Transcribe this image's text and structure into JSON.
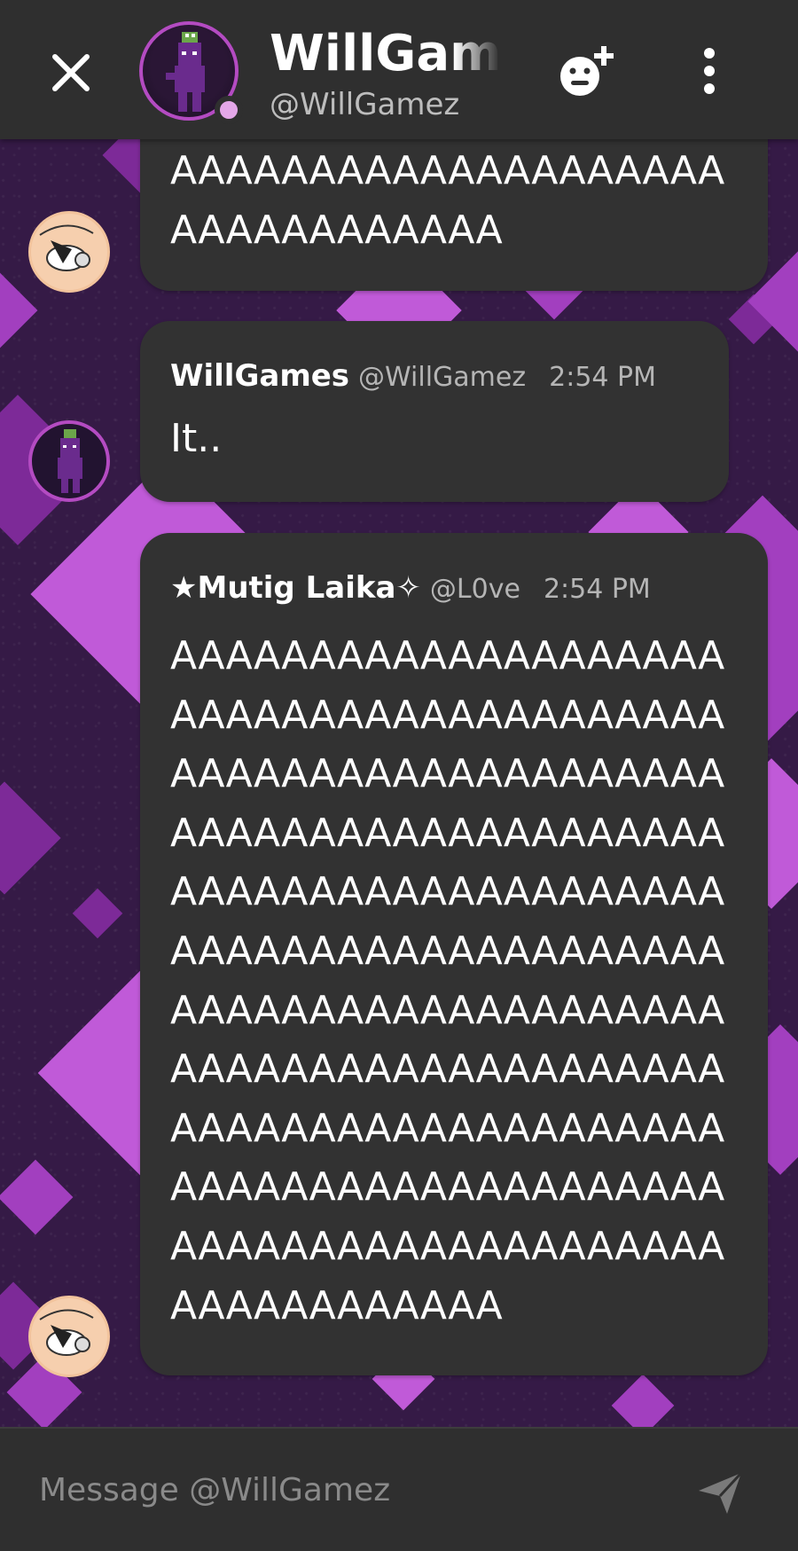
{
  "header": {
    "title": "WillGames",
    "handle": "@WillGamez"
  },
  "messages": [
    {
      "id": "partial",
      "author": "",
      "text": "AAAAAAAAAAAAAAAAAAAA\nAAAAAAAAAAAA"
    },
    {
      "id": "will",
      "author": "WillGames",
      "handle": "@WillGamez",
      "time": "2:54 PM",
      "text": "It.."
    },
    {
      "id": "laika",
      "author": "★Mutig Laika✧",
      "handle": "@L0ve",
      "time": "2:54 PM",
      "text": "AAAAAAAAAAAAAAAAAAAA\nAAAAAAAAAAAAAAAAAAAA\nAAAAAAAAAAAAAAAAAAAA\nAAAAAAAAAAAAAAAAAAAA\nAAAAAAAAAAAAAAAAAAAA\nAAAAAAAAAAAAAAAAAAAA\nAAAAAAAAAAAAAAAAAAAA\nAAAAAAAAAAAAAAAAAAAA\nAAAAAAAAAAAAAAAAAAAA\nAAAAAAAAAAAAAAAAAAAA\nAAAAAAAAAAAAAAAAAAAA\nAAAAAAAAAAAA"
    }
  ],
  "composer": {
    "placeholder": "Message @WillGamez"
  },
  "icons": {
    "close": "close-icon",
    "add_friend": "add-friend-icon",
    "more": "more-vertical-icon",
    "send": "send-icon"
  },
  "colors": {
    "background": "#351a46",
    "accent": "#b44bc2",
    "bubble": "#323232",
    "bar": "#2f2f2f"
  }
}
